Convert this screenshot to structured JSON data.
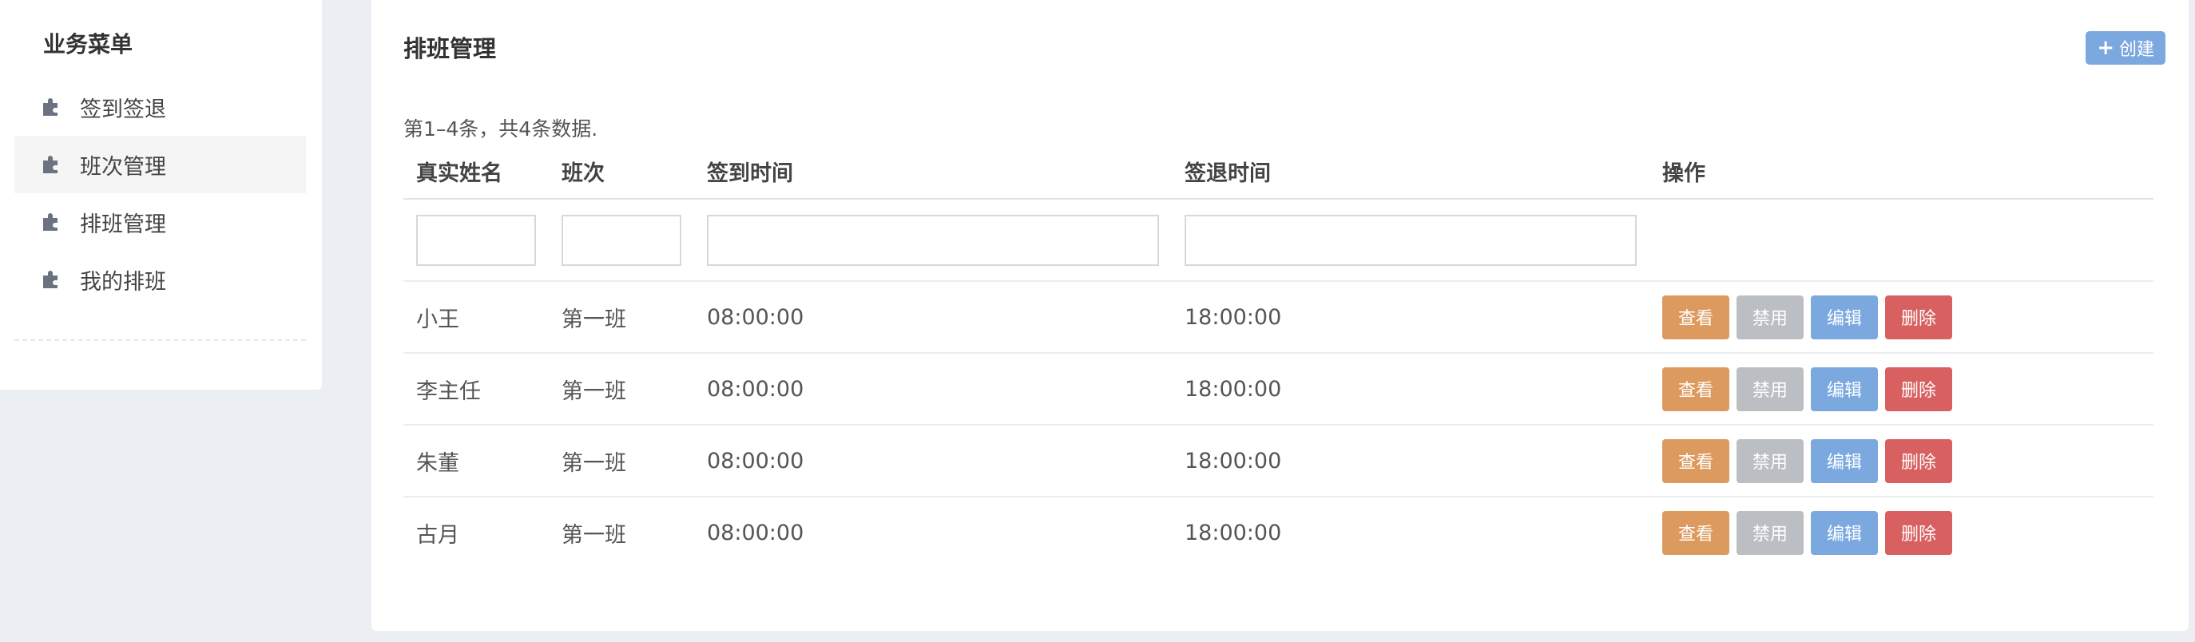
{
  "sidebar": {
    "title": "业务菜单",
    "items": [
      {
        "label": "签到签退"
      },
      {
        "label": "班次管理"
      },
      {
        "label": "排班管理"
      },
      {
        "label": "我的排班"
      }
    ]
  },
  "main": {
    "title": "排班管理",
    "create_label": "创建",
    "summary": "第1–4条，共4条数据.",
    "columns": [
      "真实姓名",
      "班次",
      "签到时间",
      "签退时间",
      "操作"
    ],
    "rows": [
      {
        "name": "小王",
        "shift": "第一班",
        "checkin": "08:00:00",
        "checkout": "18:00:00"
      },
      {
        "name": "李主任",
        "shift": "第一班",
        "checkin": "08:00:00",
        "checkout": "18:00:00"
      },
      {
        "name": "朱董",
        "shift": "第一班",
        "checkin": "08:00:00",
        "checkout": "18:00:00"
      },
      {
        "name": "古月",
        "shift": "第一班",
        "checkin": "08:00:00",
        "checkout": "18:00:00"
      }
    ],
    "actions": {
      "view": "查看",
      "disable": "禁用",
      "edit": "编辑",
      "delete": "删除"
    }
  },
  "colors": {
    "view": "#dd9a5e",
    "disable": "#bbbfc4",
    "edit": "#7ca8e0",
    "delete": "#d86060",
    "background": "#ebeef3"
  },
  "icons": {
    "menu_item": "puzzle-icon",
    "create": "plus-icon"
  }
}
